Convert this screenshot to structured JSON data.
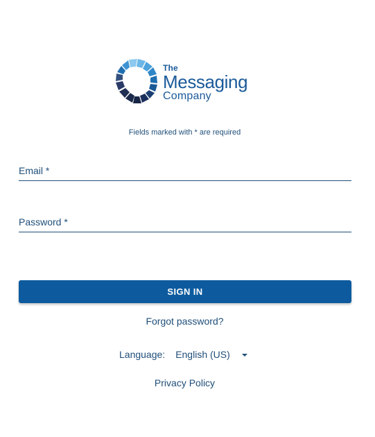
{
  "logo": {
    "line1": "The",
    "line2": "Messaging",
    "line3": "Company"
  },
  "form": {
    "required_note": "Fields marked with * are required",
    "email": {
      "label": "Email *",
      "value": ""
    },
    "password": {
      "label": "Password *",
      "value": ""
    },
    "sign_in_label": "SIGN IN",
    "forgot_label": "Forgot password?"
  },
  "language": {
    "label": "Language:",
    "selected": "English (US)",
    "icon": "caret-down-icon"
  },
  "footer": {
    "privacy_label": "Privacy Policy"
  },
  "colors": {
    "primary": "#0d5b9e",
    "text": "#1f4e79",
    "logo_light": "#6cb6e8",
    "logo_dark": "#1b2a4a"
  }
}
